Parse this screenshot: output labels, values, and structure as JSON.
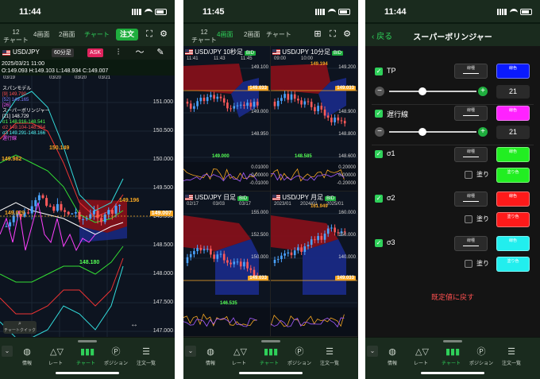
{
  "phone1": {
    "time": "11:44",
    "nav": {
      "tab_12": "12",
      "tab_12_sub": "チャート",
      "tab_4": "4画面",
      "tab_2": "2画面",
      "tab_chart": "チャート",
      "order": "注文"
    },
    "symbol": "USD/JPY",
    "timeframe": "60分足",
    "ask_chip": "ASK",
    "info_date": "2025/03/21 11:00",
    "info_ohlc": "O:149.093 H:149.103 L:148.934 C:149.007",
    "dates": [
      "03/19",
      "03/20",
      "03/20",
      "03/21"
    ],
    "legend": [
      {
        "text": "スパンモデル",
        "color": "#ffffff"
      },
      {
        "text": "[9] 149.790",
        "color": "#ff5050"
      },
      {
        "text": "[52] 149.165",
        "color": "#7d7dff"
      },
      {
        "text": "[26]",
        "color": "#ff59ff"
      },
      {
        "text": "スーパーボリンジャー",
        "color": "#ffffff"
      },
      {
        "text": "[21] 148.729",
        "color": "#ffffff"
      },
      {
        "text": "σ1 148.916-148.541",
        "color": "#55ff55"
      },
      {
        "text": "σ2 149.104-148.354",
        "color": "#ff5050"
      },
      {
        "text": "σ3 149.291-148.166",
        "color": "#55ffff"
      },
      {
        "text": "遅行線",
        "color": "#ff59ff"
      }
    ],
    "prices": [
      "151.000",
      "150.500",
      "150.000",
      "149.500",
      "149.000",
      "148.500",
      "148.000",
      "147.500",
      "147.000"
    ],
    "current_price": "149.007",
    "label_high": "149.196",
    "label_low": "148.180",
    "label_left1": "150.149",
    "label_left2": "149.982",
    "label_left3": "149.029",
    "chart_quick": "チャートクイック"
  },
  "phone2": {
    "time": "11:45",
    "nav": {
      "tab_12": "12",
      "tab_12_sub": "チャート",
      "tab_4": "4画面",
      "tab_2": "2画面",
      "tab_chart": "チャート"
    },
    "bid": "BID",
    "panels": [
      {
        "title": "USD/JPY 10秒足",
        "times": [
          "11:41",
          "11:43",
          "11:45"
        ],
        "prices": [
          "149.100",
          "149.050",
          "149.000",
          "148.950"
        ],
        "label": "149.033",
        "low": "149.000",
        "sub": [
          "0.01000",
          "0.00000",
          "-0.01000"
        ]
      },
      {
        "title": "USD/JPY 10分足",
        "times": [
          "09:00",
          "10:00"
        ],
        "prices": [
          "149.200",
          "149.000",
          "148.900",
          "148.800",
          "148.600"
        ],
        "label": "149.033",
        "high": "149.194",
        "low": "148.585",
        "sub": [
          "0.20000",
          "0.00000",
          "-0.20000"
        ]
      },
      {
        "title": "USD/JPY 日足",
        "times": [
          "02/17",
          "03/03",
          "03/17"
        ],
        "prices": [
          "155.000",
          "152.500",
          "150.000",
          "147.500"
        ],
        "label": "149.033",
        "low": "146.535",
        "sub": []
      },
      {
        "title": "USD/JPY 月足",
        "times": [
          "2023/01",
          "2024/01",
          "2025/01"
        ],
        "prices": [
          "160.000",
          "150.000",
          "140.000",
          "130.000"
        ],
        "label": "149.033",
        "high": "161.949",
        "sub": []
      }
    ]
  },
  "phone3": {
    "time": "11:44",
    "back": "戻る",
    "title": "スーパーボリンジャー",
    "line_label": "線種",
    "color_label": "線色",
    "fill_label": "塗り色",
    "paint": "塗り",
    "rows": {
      "tp": {
        "label": "TP",
        "value": "21",
        "color": "#0a1aff"
      },
      "chikou": {
        "label": "遅行線",
        "value": "21",
        "color": "#ff22ff"
      },
      "s1": {
        "label": "σ1",
        "color": "#22ee22",
        "fill": "#22ee22"
      },
      "s2": {
        "label": "σ2",
        "color": "#ff1a1a",
        "fill": "#ff1a1a"
      },
      "s3": {
        "label": "σ3",
        "color": "#22eeee",
        "fill": "#22eeee"
      }
    },
    "reset": "既定値に戻す"
  },
  "tabbar": [
    "情報",
    "レート",
    "チャート",
    "ポジション",
    "注文一覧"
  ]
}
